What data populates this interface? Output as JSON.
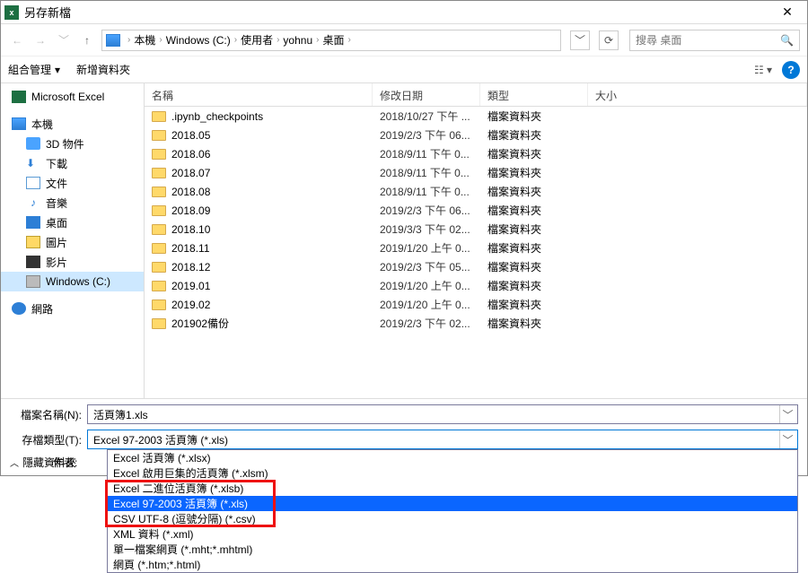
{
  "title": "另存新檔",
  "breadcrumbs": [
    "本機",
    "Windows (C:)",
    "使用者",
    "yohnu",
    "桌面"
  ],
  "search_placeholder": "搜尋 桌面",
  "toolbar": {
    "organize": "組合管理",
    "new_folder": "新增資料夾"
  },
  "sidebar": {
    "excel": "Microsoft Excel",
    "thispc": "本機",
    "items": [
      "3D 物件",
      "下載",
      "文件",
      "音樂",
      "桌面",
      "圖片",
      "影片",
      "Windows (C:)"
    ],
    "network": "網路"
  },
  "columns": {
    "name": "名稱",
    "date": "修改日期",
    "type": "類型",
    "size": "大小"
  },
  "type_folder": "檔案資料夾",
  "rows": [
    {
      "name": ".ipynb_checkpoints",
      "date": "2018/10/27 下午 ..."
    },
    {
      "name": "2018.05",
      "date": "2019/2/3 下午 06..."
    },
    {
      "name": "2018.06",
      "date": "2018/9/11 下午 0..."
    },
    {
      "name": "2018.07",
      "date": "2018/9/11 下午 0..."
    },
    {
      "name": "2018.08",
      "date": "2018/9/11 下午 0..."
    },
    {
      "name": "2018.09",
      "date": "2019/2/3 下午 06..."
    },
    {
      "name": "2018.10",
      "date": "2019/3/3 下午 02..."
    },
    {
      "name": "2018.11",
      "date": "2019/1/20 上午 0..."
    },
    {
      "name": "2018.12",
      "date": "2019/2/3 下午 05..."
    },
    {
      "name": "2019.01",
      "date": "2019/1/20 上午 0..."
    },
    {
      "name": "2019.02",
      "date": "2019/1/20 上午 0..."
    },
    {
      "name": "201902備份",
      "date": "2019/2/3 下午 02..."
    }
  ],
  "labels": {
    "filename": "檔案名稱(N):",
    "filetype": "存檔類型(T):",
    "author": "作者:",
    "hide_folders": "隱藏資料夾"
  },
  "filename_value": "活頁簿1.xls",
  "filetype_selected": "Excel 97-2003 活頁簿 (*.xls)",
  "filetype_options": [
    "Excel 活頁簿 (*.xlsx)",
    "Excel 啟用巨集的活頁簿 (*.xlsm)",
    "Excel 二進位活頁簿 (*.xlsb)",
    "Excel 97-2003 活頁簿 (*.xls)",
    "CSV UTF-8 (逗號分隔) (*.csv)",
    "XML 資料 (*.xml)",
    "單一檔案網頁 (*.mht;*.mhtml)",
    "網頁 (*.htm;*.html)"
  ],
  "filetype_selected_index": 3
}
